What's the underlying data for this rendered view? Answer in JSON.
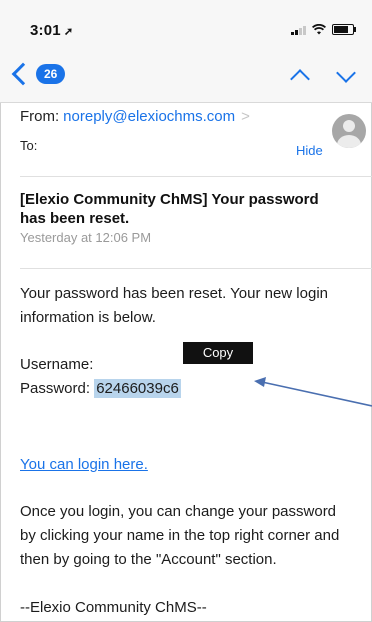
{
  "status_bar": {
    "time": "3:01",
    "location_icon": "location-arrow-icon",
    "signal_icon": "cellular-signal-icon",
    "wifi_icon": "wifi-icon",
    "battery_icon": "battery-icon",
    "battery_level": 0.8
  },
  "nav": {
    "back_icon": "chevron-left-icon",
    "unread_count": "26",
    "prev_icon": "chevron-up-icon",
    "next_icon": "chevron-down-icon"
  },
  "header": {
    "from_label": "From:",
    "sender": "noreply@elexiochms.com",
    "sender_chevron": ">",
    "to_label": "To:",
    "hide_label": "Hide",
    "avatar_icon": "person-icon"
  },
  "message": {
    "subject": "[Elexio Community ChMS] Your password has been reset.",
    "date": "Yesterday at 12:06 PM",
    "intro": "Your password has been reset. Your new login information is below.",
    "username_label": "Username:",
    "password_label": "Password:",
    "password_value": "62466039c6",
    "login_link": "You can login here.",
    "instructions": "Once you login, you can change your password by clicking your name in the top right corner and then by going to the \"Account\" section.",
    "signature": "--Elexio Community ChMS--"
  },
  "popup": {
    "copy_label": "Copy"
  },
  "colors": {
    "accent": "#1a73e8",
    "selection": "#b8d4ec",
    "annotation_arrow": "#4a6fb0"
  }
}
